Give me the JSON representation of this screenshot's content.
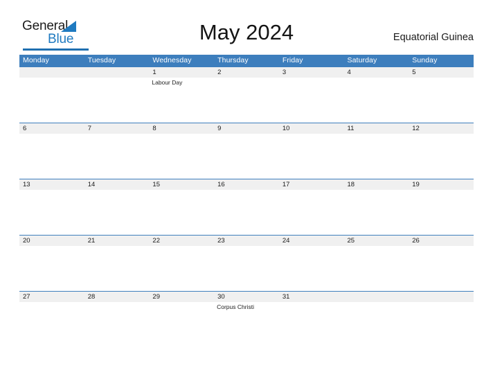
{
  "branding": {
    "logo_primary": "General",
    "logo_secondary": "Blue",
    "accent_color": "#1f7ac0"
  },
  "header": {
    "title": "May 2024",
    "region": "Equatorial Guinea"
  },
  "colors": {
    "header_band": "#3d7ebd",
    "daynum_band": "#f0f0f0",
    "page_background": "#ffffff",
    "text": "#1a1a1a"
  },
  "calendar": {
    "month": "May",
    "year": "2024",
    "weekdays": [
      "Monday",
      "Tuesday",
      "Wednesday",
      "Thursday",
      "Friday",
      "Saturday",
      "Sunday"
    ],
    "weeks": [
      {
        "days": [
          {
            "num": "",
            "event": ""
          },
          {
            "num": "",
            "event": ""
          },
          {
            "num": "1",
            "event": "Labour Day"
          },
          {
            "num": "2",
            "event": ""
          },
          {
            "num": "3",
            "event": ""
          },
          {
            "num": "4",
            "event": ""
          },
          {
            "num": "5",
            "event": ""
          }
        ]
      },
      {
        "days": [
          {
            "num": "6",
            "event": ""
          },
          {
            "num": "7",
            "event": ""
          },
          {
            "num": "8",
            "event": ""
          },
          {
            "num": "9",
            "event": ""
          },
          {
            "num": "10",
            "event": ""
          },
          {
            "num": "11",
            "event": ""
          },
          {
            "num": "12",
            "event": ""
          }
        ]
      },
      {
        "days": [
          {
            "num": "13",
            "event": ""
          },
          {
            "num": "14",
            "event": ""
          },
          {
            "num": "15",
            "event": ""
          },
          {
            "num": "16",
            "event": ""
          },
          {
            "num": "17",
            "event": ""
          },
          {
            "num": "18",
            "event": ""
          },
          {
            "num": "19",
            "event": ""
          }
        ]
      },
      {
        "days": [
          {
            "num": "20",
            "event": ""
          },
          {
            "num": "21",
            "event": ""
          },
          {
            "num": "22",
            "event": ""
          },
          {
            "num": "23",
            "event": ""
          },
          {
            "num": "24",
            "event": ""
          },
          {
            "num": "25",
            "event": ""
          },
          {
            "num": "26",
            "event": ""
          }
        ]
      },
      {
        "days": [
          {
            "num": "27",
            "event": ""
          },
          {
            "num": "28",
            "event": ""
          },
          {
            "num": "29",
            "event": ""
          },
          {
            "num": "30",
            "event": "Corpus Christi"
          },
          {
            "num": "31",
            "event": ""
          },
          {
            "num": "",
            "event": ""
          },
          {
            "num": "",
            "event": ""
          }
        ]
      }
    ]
  }
}
